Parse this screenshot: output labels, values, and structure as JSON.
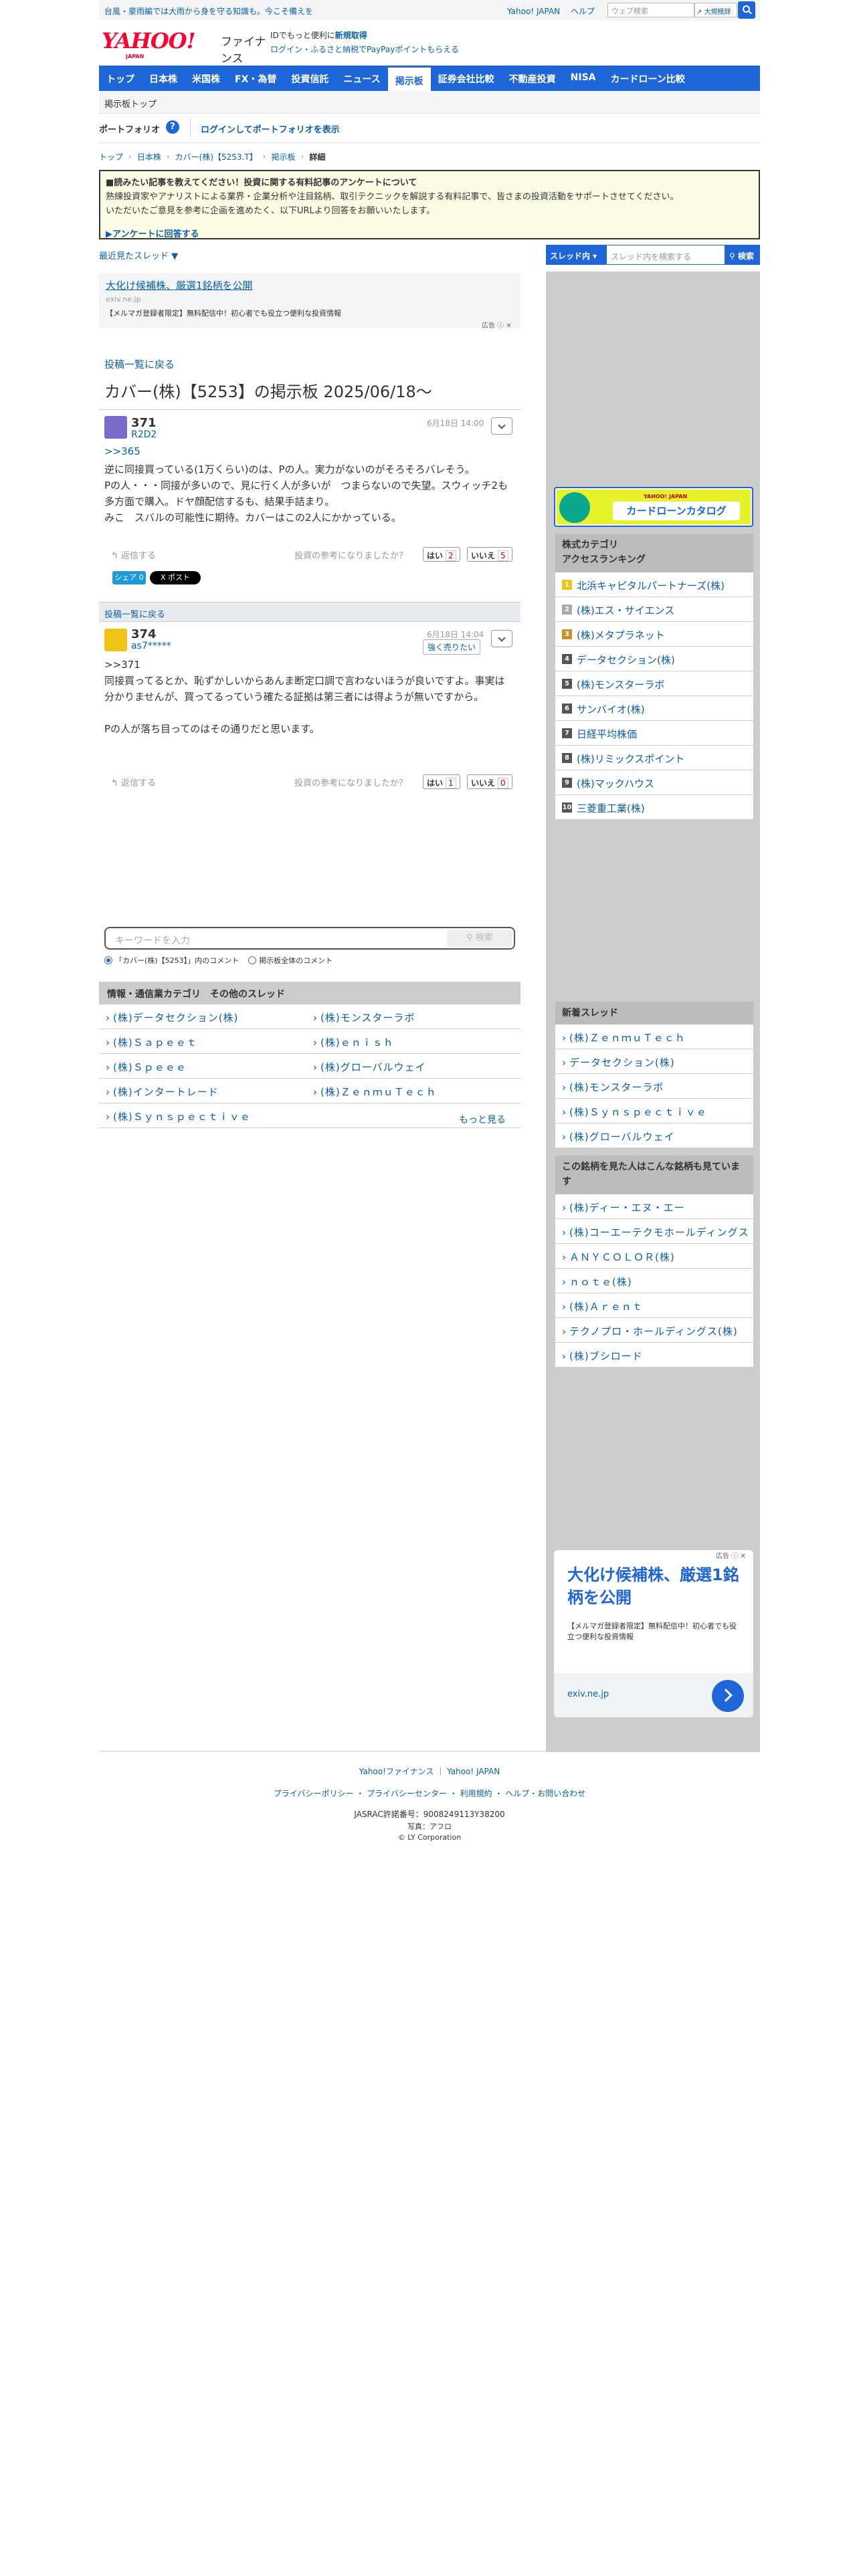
{
  "topbar": {
    "promo": "台風・豪雨編では大雨から身を守る知識も。今こそ備えを",
    "links": [
      "Yahoo! JAPAN",
      "ヘルプ"
    ],
    "search_placeholder": "ウェブ検索",
    "dict": "大規模辞"
  },
  "logo": {
    "yahoo": "YAHOO!",
    "japan": "JAPAN",
    "finance": "ファイナンス"
  },
  "catch": {
    "line1_pre": "IDでもっと便利に",
    "line1_link": "新規取得",
    "line2": "ログイン・ふるさと納税でPayPayポイントもらえる"
  },
  "nav": [
    "トップ",
    "日本株",
    "米国株",
    "FX・為替",
    "投資信託",
    "ニュース",
    "掲示板",
    "証券会社比較",
    "不動産投資",
    "NISA",
    "カードローン比較"
  ],
  "nav_active": "掲示板",
  "subnav": "掲示板トップ",
  "portfolio": {
    "title": "ポートフォリオ",
    "help": "?",
    "login": "ログインしてポートフォリオを表示"
  },
  "breadcrumb": [
    "トップ",
    "日本株",
    "カバー(株)【5253.T】",
    "掲示板",
    "詳細"
  ],
  "notice": {
    "title": "■読みたい記事を教えてください！投資に関する有料記事のアンケートについて",
    "body1": "熟練投資家やアナリストによる業界・企業分析や注目銘柄、取引テクニックを解説する有料記事で、皆さまの投資活動をサポートさせてください。",
    "body2": "いただいたご意見を参考に企画を進めたく、以下URLより回答をお願いいたします。",
    "link": "▶アンケートに回答する"
  },
  "recent": "最近見たスレッド ▼",
  "ad1": {
    "title": "大化け候補株、厳選1銘柄を公開",
    "domain": "exiv.ne.jp",
    "desc": "【メルマガ登録者限定】無料配信中！初心者でも役立つ便利な投資情報",
    "tag": "広告 ⓘ ✕"
  },
  "back_link": "投稿一覧に戻る",
  "page_title": "カバー(株)【5253】の掲示板 2025/06/18〜",
  "posts": [
    {
      "num": "371",
      "user": "R2D2",
      "date": "6月18日 14:00",
      "reply_to": ">>365",
      "body": "逆に同接買っている(1万くらい)のは、Pの人。実力がないのがそろそろバレそう。\nPの人・・・同接が多いので、見に行く人が多いが　つまらないので失望。スウィッチ2も多方面で購入。ドヤ顔配信するも、結果手詰まり。\nみこ　スバルの可能性に期待。カバーはこの2人にかかっている。",
      "reply": "返信する",
      "vote_q": "投資の参考になりましたか？",
      "yes": "はい",
      "yes_n": "2",
      "no": "いいえ",
      "no_n": "5"
    },
    {
      "num": "374",
      "user": "as7*****",
      "date": "6月18日 14:04",
      "badge": "強く売りたい",
      "body": ">>371\n同接買ってるとか、恥ずかしいからあんま断定口調で言わないほうが良いですよ。事実は分かりませんが、買ってるっていう確たる証拠は第三者には得ようが無いですから。\n\nPの人が落ち目ってのはその通りだと思います。",
      "reply": "返信する",
      "vote_q": "投資の参考になりましたか？",
      "yes": "はい",
      "yes_n": "1",
      "no": "いいえ",
      "no_n": "0"
    }
  ],
  "share": {
    "fb": "シェア 0",
    "x": "X ポスト"
  },
  "backbar": "投稿一覧に戻る",
  "thread_search": {
    "placeholder": "キーワードを入力",
    "button": "検索",
    "opt1": "「カバー(株)【5253】」内のコメント",
    "opt2": "掲示板全体のコメント"
  },
  "category": {
    "title": "情報・通信業カテゴリ　その他のスレッド",
    "rows": [
      [
        "(株)データセクション(株)",
        "(株)モンスターラボ"
      ],
      [
        "(株)Ｓａｐｅｅｔ",
        "(株)ｅｎｉｓｈ"
      ],
      [
        "(株)Ｓｐｅｅｅ",
        "(株)グローバルウェイ"
      ],
      [
        "(株)インタートレード",
        "(株)ＺｅｎｍｕＴｅｃｈ"
      ],
      [
        "(株)Ｓｙｎｓｐｅｃｔｉｖｅ",
        ""
      ]
    ],
    "more": "もっと見る"
  },
  "right": {
    "search_btn": "スレッド内 ▾",
    "search_placeholder": "スレッド内を検索する",
    "search_go": "検索",
    "loan_title": "カードローンカタログ",
    "loan_sub": "YAHOO! JAPAN",
    "ranking_title": "株式カテゴリ\nアクセスランキング",
    "ranking": [
      {
        "rank": "1",
        "name": "北浜キャピタルパートナーズ(株)",
        "color": "#f0c419"
      },
      {
        "rank": "2",
        "name": "(株)エス・サイエンス",
        "color": "#aaaaaa"
      },
      {
        "rank": "3",
        "name": "(株)メタプラネット",
        "color": "#c8922a"
      },
      {
        "rank": "4",
        "name": "データセクション(株)",
        "color": "#555555"
      },
      {
        "rank": "5",
        "name": "(株)モンスターラボ",
        "color": "#555555"
      },
      {
        "rank": "6",
        "name": "サンバイオ(株)",
        "color": "#555555"
      },
      {
        "rank": "7",
        "name": "日経平均株価",
        "color": "#555555"
      },
      {
        "rank": "8",
        "name": "(株)リミックスポイント",
        "color": "#555555"
      },
      {
        "rank": "9",
        "name": "(株)マックハウス",
        "color": "#555555"
      },
      {
        "rank": "10",
        "name": "三菱重工業(株)",
        "color": "#555555"
      }
    ],
    "new_title": "新着スレッド",
    "new_threads": [
      "(株)ＺｅｎｍｕＴｅｃｈ",
      "データセクション(株)",
      "(株)モンスターラボ",
      "(株)Ｓｙｎｓｐｅｃｔｉｖｅ",
      "(株)グローバルウェイ"
    ],
    "also_title": "この銘柄を見た人はこんな銘柄も見ています",
    "also": [
      "(株)ディー・エヌ・エー",
      "(株)コーエーテクモホールディングス",
      "ＡＮＹＣＯＬＯＲ(株)",
      "ｎｏｔｅ(株)",
      "(株)Ａｒｅｎｔ",
      "テクノプロ・ホールディングス(株)",
      "(株)ブシロード"
    ],
    "ad2": {
      "title": "大化け候補株、厳選1銘柄を公開",
      "desc": "【メルマガ登録者限定】無料配信中！初心者でも役立つ便利な投資情報",
      "domain": "exiv.ne.jp",
      "tag": "広告 ⓘ ✕"
    }
  },
  "footer": {
    "row1": [
      "Yahoo!ファイナンス",
      "Yahoo! JAPAN"
    ],
    "row2": [
      "プライバシーポリシー",
      "プライバシーセンター",
      "利用規約",
      "ヘルプ・お問い合わせ"
    ],
    "jasrac": "JASRAC許諾番号：9008249113Y38200",
    "photo": "写真：アフロ",
    "copy": "© LY Corporation"
  },
  "colors": {
    "brand_blue": "#1e66d8",
    "yahoo_red": "#ff0033"
  }
}
